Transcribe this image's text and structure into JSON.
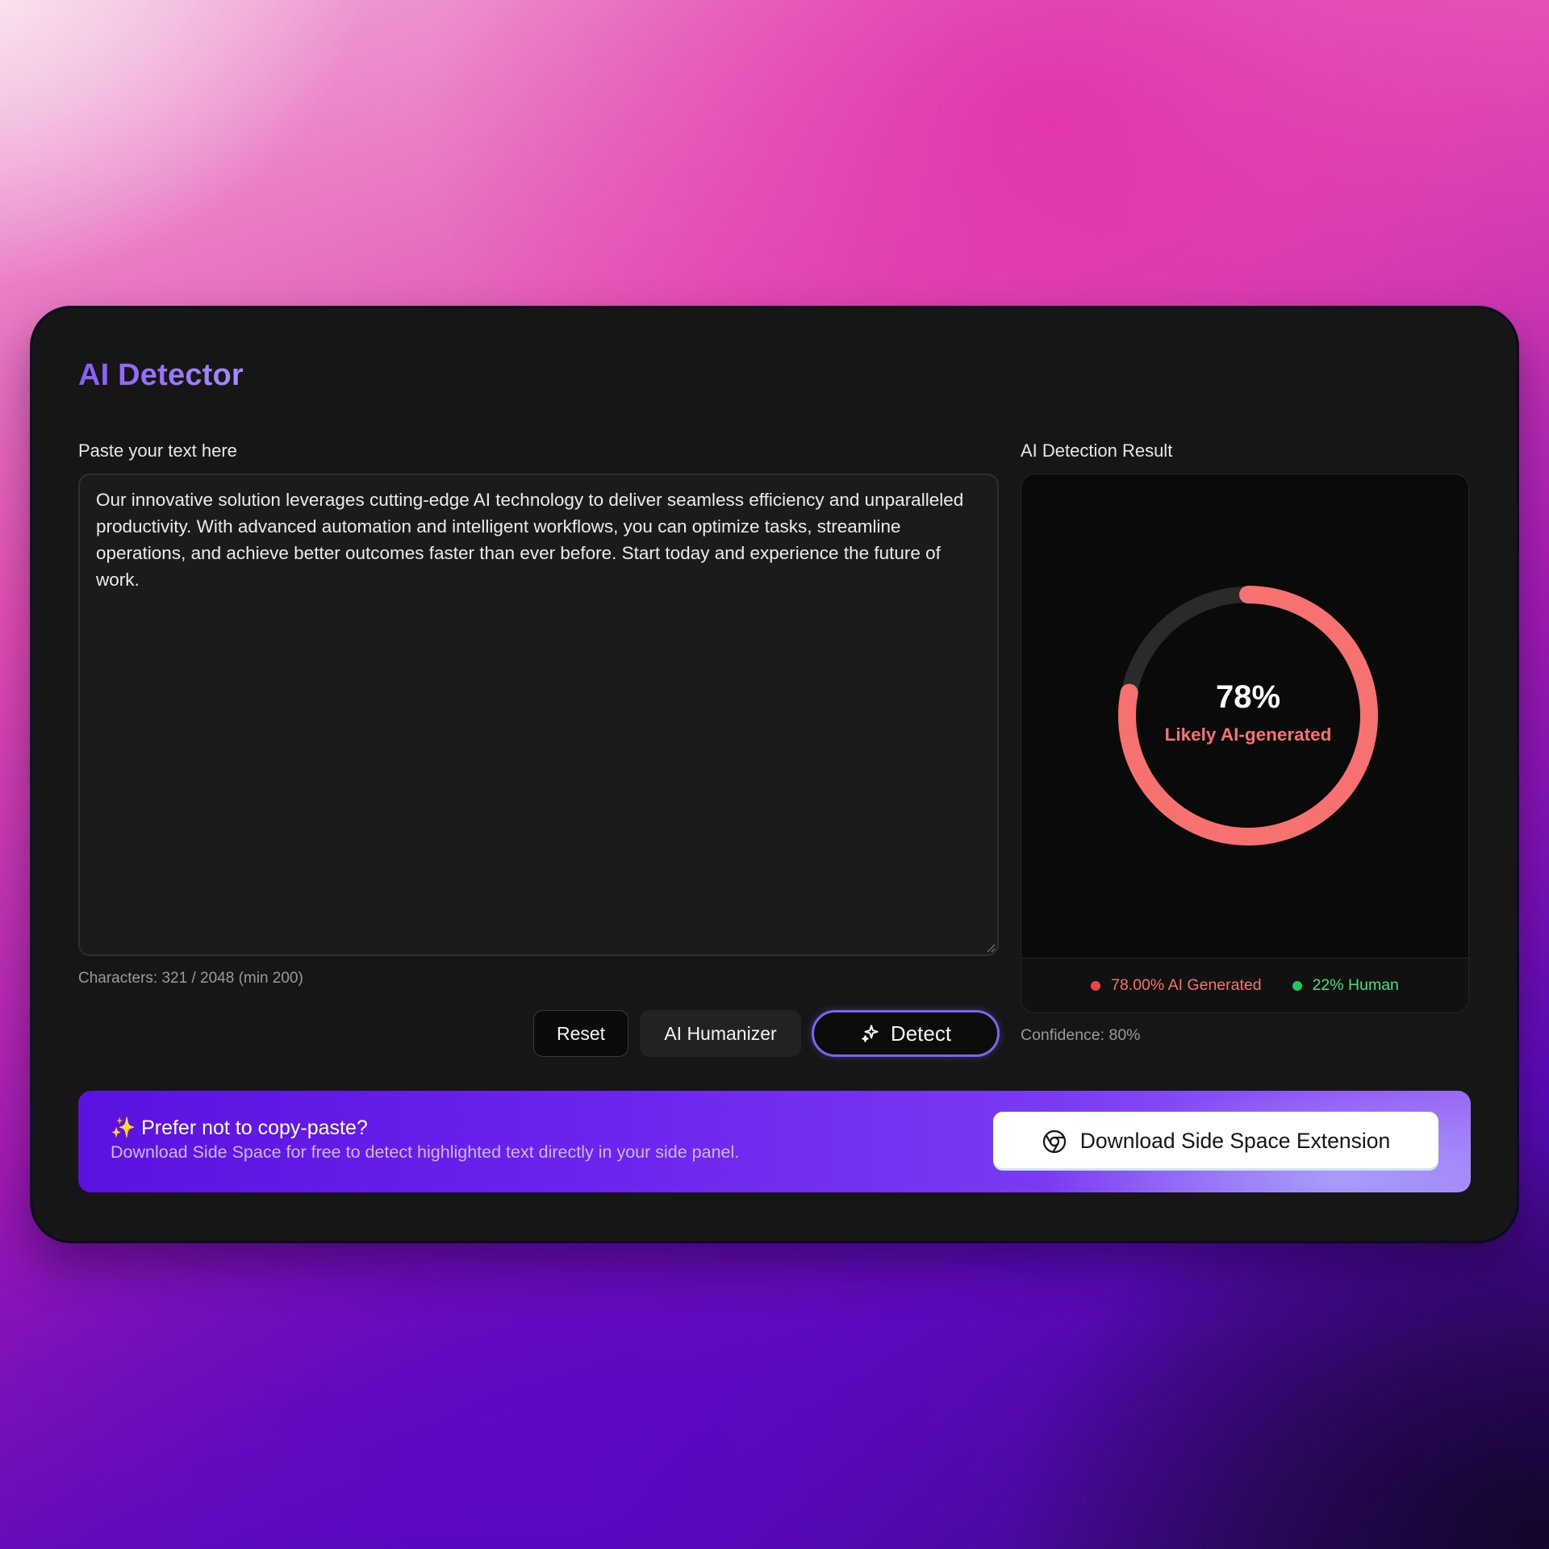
{
  "app": {
    "title": "AI Detector"
  },
  "input": {
    "label": "Paste your text here",
    "value": "Our innovative solution leverages cutting-edge AI technology to deliver seamless efficiency and unparalleled productivity. With advanced automation and intelligent workflows, you can optimize tasks, streamline operations, and achieve better outcomes faster than ever before. Start today and experience the future of work.",
    "char_count": "Characters: 321 / 2048 (min 200)"
  },
  "actions": {
    "reset_label": "Reset",
    "humanizer_label": "AI Humanizer",
    "detect_label": "Detect",
    "detect_icon": "sparkles-icon"
  },
  "result": {
    "label": "AI Detection Result",
    "percent_text": "78%",
    "ai_fraction": 0.78,
    "verdict": "Likely AI-generated",
    "legend_ai": "78.00% AI Generated",
    "legend_human": "22% Human",
    "confidence": "Confidence: 80%"
  },
  "promo": {
    "title": "✨ Prefer not to copy-paste?",
    "subtitle": "Download Side Space for free to detect highlighted text directly in your side panel.",
    "button_label": "Download Side Space Extension",
    "button_icon": "chrome-icon"
  },
  "colors": {
    "accent_purple": "#8b5cf6",
    "ai_red": "#f87171",
    "ai_red_dot": "#ef4444",
    "human_green": "#22c55e",
    "detect_border": "#7c65f0",
    "gauge_track": "#2a2a2a"
  }
}
